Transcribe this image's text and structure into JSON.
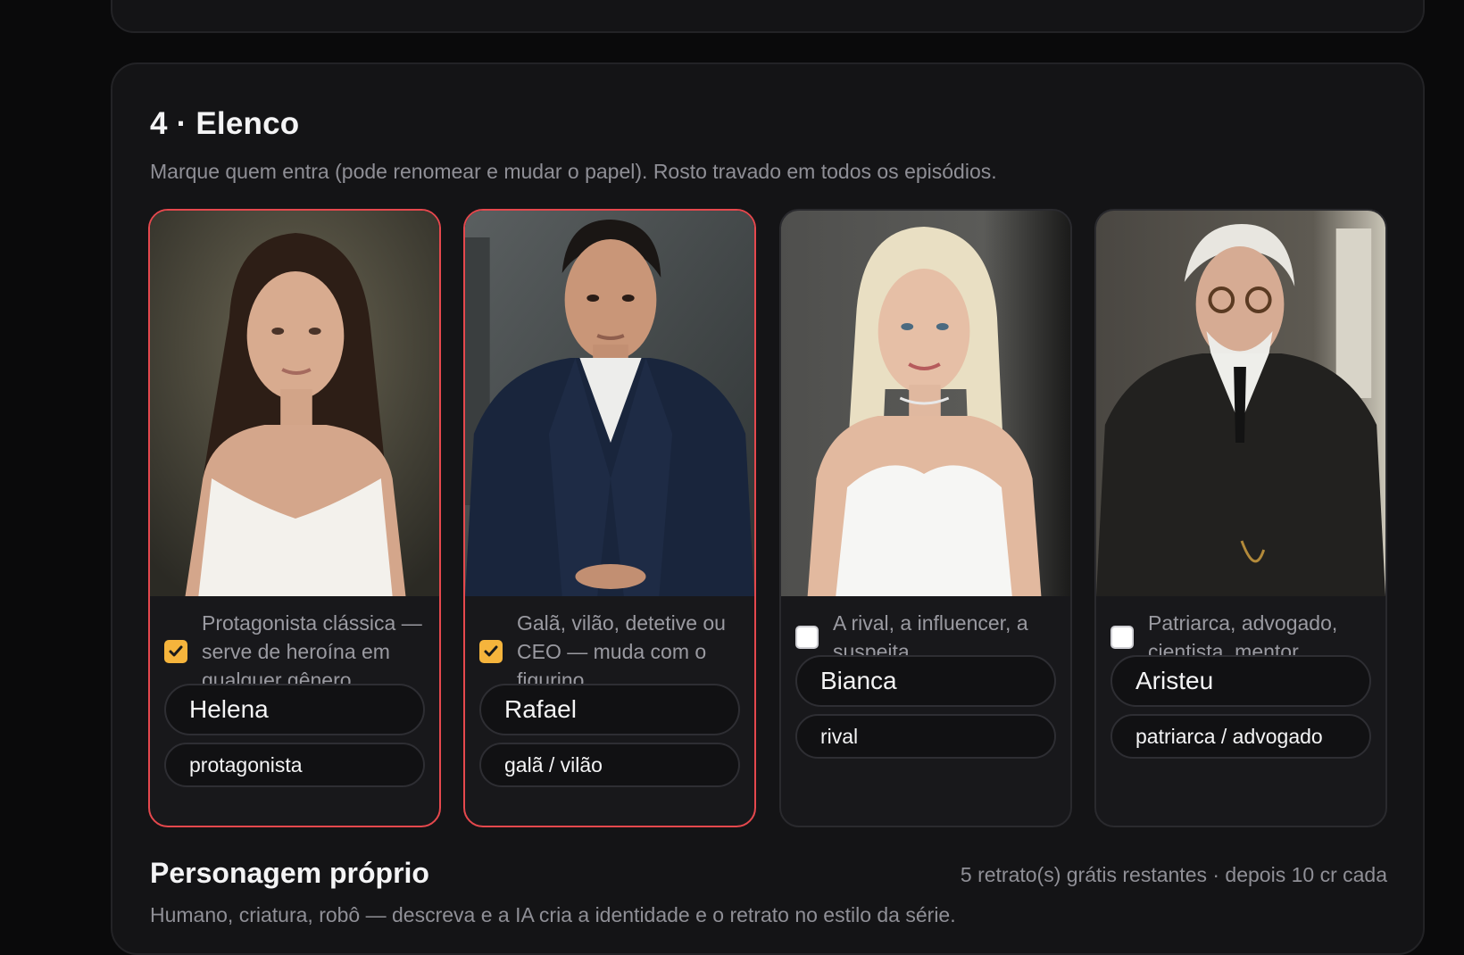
{
  "section": {
    "title": "4 · Elenco",
    "subtitle": "Marque quem entra (pode renomear e mudar o papel). Rosto travado em todos os episódios."
  },
  "cast": [
    {
      "selected": true,
      "description": "Protagonista clássica — serve de heroína em qualquer gênero.",
      "name": "Helena",
      "role": "protagonista",
      "photo_alt": "portrait-woman-dark-hair-white-dress"
    },
    {
      "selected": true,
      "description": "Galã, vilão, detetive ou CEO — muda com o figurino.",
      "name": "Rafael",
      "role": "galã / vilão",
      "photo_alt": "portrait-man-navy-suit"
    },
    {
      "selected": false,
      "description": "A rival, a influencer, a suspeita.",
      "name": "Bianca",
      "role": "rival",
      "photo_alt": "portrait-woman-blonde-white-dress"
    },
    {
      "selected": false,
      "description": "Patriarca, advogado, cientista, mentor.",
      "name": "Aristeu",
      "role": "patriarca / advogado",
      "photo_alt": "portrait-older-man-glasses-suit"
    }
  ],
  "custom": {
    "title": "Personagem próprio",
    "meta": "5 retrato(s) grátis restantes · depois 10 cr cada",
    "subtitle": "Humano, criatura, robô — descreva e a IA cria a identidade e o retrato no estilo da série."
  },
  "colors": {
    "accent_selected_border": "#e5484d",
    "checkbox_on": "#f5b43c",
    "panel_bg": "#141416"
  }
}
